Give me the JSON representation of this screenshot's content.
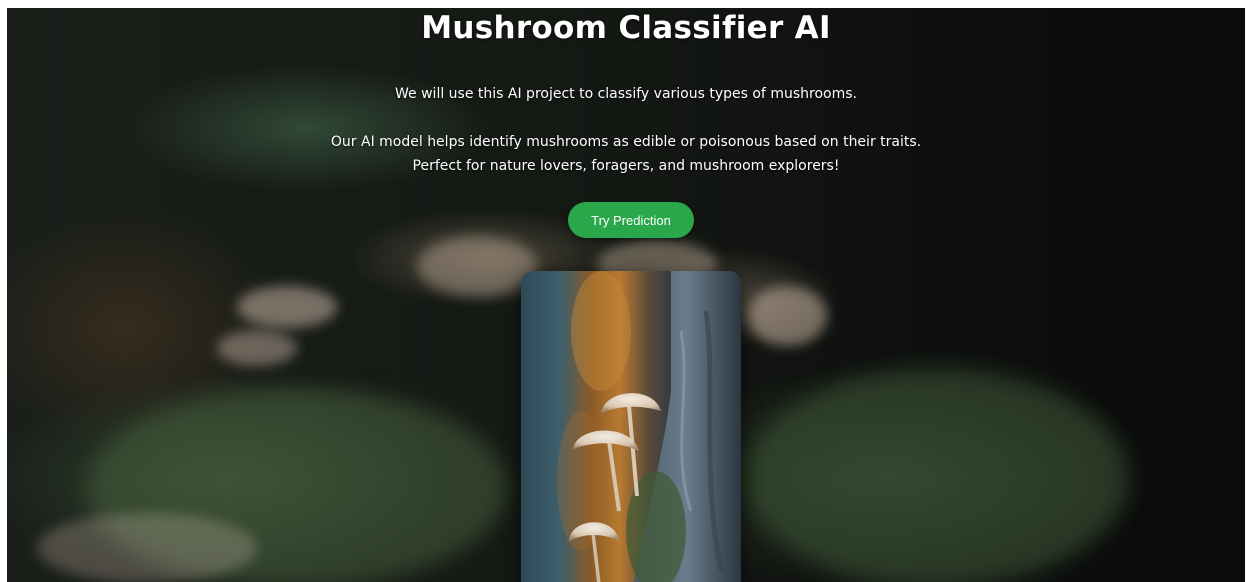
{
  "hero": {
    "title": "Mushroom Classifier AI",
    "intro": "We will use this AI project to classify various types of mushrooms.",
    "description": "Our AI model helps identify mushrooms as edible or poisonous based on their traits. Perfect for nature lovers, foragers, and mushroom explorers!",
    "cta_label": "Try Prediction"
  },
  "colors": {
    "cta_background": "#2aa74a",
    "text": "#ffffff"
  },
  "images": {
    "background": "forest-moss-mushrooms-background",
    "card": "mushroom-cluster-photo"
  }
}
